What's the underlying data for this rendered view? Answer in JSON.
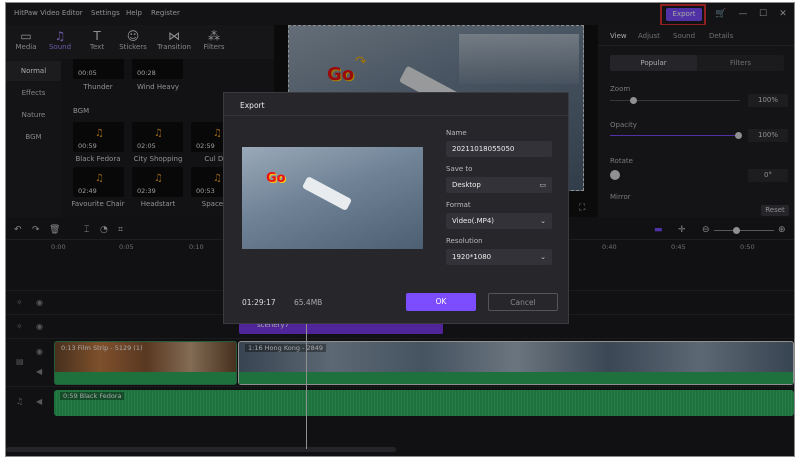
{
  "app": {
    "title": "HitPaw Video Editor",
    "menu": [
      "Settings",
      "Help",
      "Register"
    ],
    "export_label": "Export",
    "accent": "#7c4dff"
  },
  "toolbar": [
    "Media",
    "Sound",
    "Text",
    "Stickers",
    "Transition",
    "Filters"
  ],
  "sound_categories": [
    "Normal",
    "Effects",
    "Nature",
    "BGM"
  ],
  "sounds_top": [
    {
      "duration": "00:05",
      "name": "Thunder"
    },
    {
      "duration": "00:28",
      "name": "Wind Heavy"
    }
  ],
  "bgm_header": "BGM",
  "bgm_row1": [
    {
      "duration": "00:59",
      "name": "Black Fedora"
    },
    {
      "duration": "02:05",
      "name": "City Shopping"
    },
    {
      "duration": "02:59",
      "name": "Cul De"
    }
  ],
  "bgm_row2": [
    {
      "duration": "02:49",
      "name": "Favourite Chair"
    },
    {
      "duration": "02:39",
      "name": "Headstart"
    },
    {
      "duration": "00:53",
      "name": "Space C"
    }
  ],
  "sticker_text": "Go",
  "right_panel": {
    "tabs": [
      "View",
      "Adjust",
      "Sound",
      "Details"
    ],
    "subtabs": [
      "Popular",
      "Filters"
    ],
    "zoom_label": "Zoom",
    "zoom_value": "100%",
    "opacity_label": "Opacity",
    "opacity_value": "100%",
    "rotate_label": "Rotate",
    "rotate_value": "0°",
    "mirror_label": "Mirror",
    "reset_label": "Reset"
  },
  "timeline": {
    "ticks": [
      "0:00",
      "0:05",
      "0:10",
      "0:40",
      "0:45",
      "0:50"
    ],
    "text_clip": "scenery7",
    "clip1": "0:13   Film Strip - 5129 (1)",
    "clip2": "1:16   Hong Kong - 2849",
    "audio_clip": "0:59   Black Fedora"
  },
  "dialog": {
    "title": "Export",
    "name_label": "Name",
    "name_value": "20211018055050",
    "save_label": "Save to",
    "save_value": "Desktop",
    "format_label": "Format",
    "format_value": "Video(.MP4)",
    "resolution_label": "Resolution",
    "resolution_value": "1920*1080",
    "duration": "01:29:17",
    "size": "65.4MB",
    "ok_label": "OK",
    "cancel_label": "Cancel"
  }
}
